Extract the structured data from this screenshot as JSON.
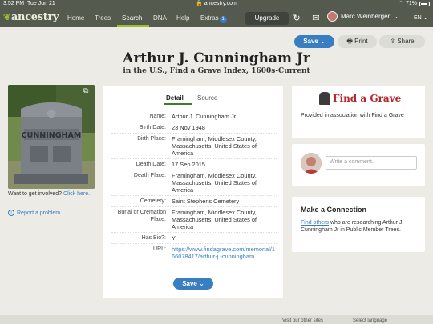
{
  "status": {
    "time": "3:52 PM",
    "date": "Tue Jun 21",
    "url": "ancestry.com",
    "battery": "71%"
  },
  "nav": {
    "logo": "ancestry",
    "items": [
      "Home",
      "Trees",
      "Search",
      "DNA",
      "Help",
      "Extras"
    ],
    "extras_badge": "1",
    "upgrade": "Upgrade",
    "user": "Marc Weinberger",
    "lang": "EN"
  },
  "actions": {
    "save": "Save",
    "print": "Print",
    "share": "Share"
  },
  "header": {
    "title": "Arthur J. Cunningham Jr",
    "subtitle": "in the U.S., Find a Grave Index, 1600s-Current"
  },
  "left": {
    "want_text": "Want to get involved?",
    "want_link": "Click here.",
    "report": "Report a problem",
    "stone_name": "CUNNINGHAM"
  },
  "tabs": {
    "detail": "Detail",
    "source": "Source"
  },
  "fields": [
    {
      "label": "Name:",
      "value": "Arthur J. Cunningham Jr"
    },
    {
      "label": "Birth Date:",
      "value": "23 Nov 1948"
    },
    {
      "label": "Birth Place:",
      "value": "Framingham, Middlesex County, Massachusetts, United States of America"
    },
    {
      "label": "Death Date:",
      "value": "17 Sep 2015"
    },
    {
      "label": "Death Place:",
      "value": "Framingham, Middlesex County, Massachusetts, United States of America"
    },
    {
      "label": "Cemetery:",
      "value": "Saint Stephens Cemetery"
    },
    {
      "label": "Burial or Cremation Place:",
      "value": "Framingham, Middlesex County, Massachusetts, United States of America"
    },
    {
      "label": "Has Bio?:",
      "value": "Y"
    },
    {
      "label": "URL:",
      "value": "https://www.findagrave.com/memorial/166078417/arthur-j.-cunningham"
    }
  ],
  "save_bottom": "Save",
  "findagrave": {
    "logo": "Find a Grave",
    "text": "Provided in association with Find a Grave"
  },
  "comment": {
    "placeholder": "Write a comment."
  },
  "connection": {
    "title": "Make a Connection",
    "link": "Find others",
    "text": " who are researching Arthur J. Cunningham Jr in Public Member Trees."
  },
  "footer": {
    "visit": "Visit our other sites",
    "lang": "Select language"
  }
}
